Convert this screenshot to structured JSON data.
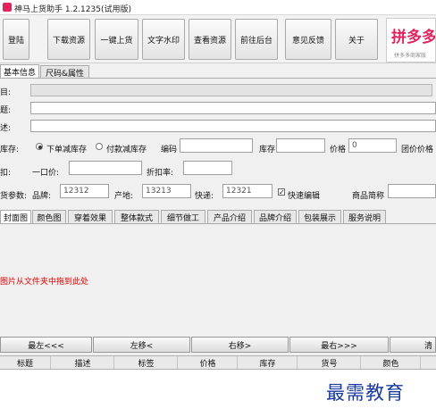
{
  "window": {
    "title": "神马上货助手 1.2.1235(试用版)"
  },
  "toolbar": {
    "buttons": [
      "登陆",
      "下载资源",
      "一键上货",
      "文字水印",
      "查看资源",
      "前往后台",
      "意见反馈",
      "关于"
    ]
  },
  "brand": {
    "logo_text": "拼多多",
    "sub_text": "拼多多商家版"
  },
  "main_tabs": [
    "基本信息",
    "尺码&属性"
  ],
  "form": {
    "category_label": "目:",
    "title_label": "题:",
    "desc_label": "述:",
    "stock_label": "库存:",
    "stock_options": [
      "下单减库存",
      "付款减库存"
    ],
    "code_label": "编码",
    "code_value": "",
    "stock_qty_label": "库存",
    "stock_qty_value": "",
    "price_label": "价格",
    "price_value": "0",
    "group_price_label": "团价价格",
    "discount_label": "扣:",
    "single_price_label": "一口价:",
    "single_price_value": "",
    "discount_rate_label": "折扣率:",
    "discount_rate_value": "",
    "goods_params_label": "货参数:",
    "brand_label": "品牌:",
    "brand_value": "12312",
    "origin_label": "产地:",
    "origin_value": "13213",
    "express_label": "快递:",
    "express_value": "12321",
    "quick_edit_label": "快速编辑",
    "quick_edit_checked": "✓",
    "short_name_label": "商品简称",
    "short_name_value": ""
  },
  "image_tabs": [
    "封面图",
    "颜色图",
    "穿着效果",
    "整体款式",
    "细节做工",
    "产品介绍",
    "品牌介绍",
    "包装展示",
    "服务说明"
  ],
  "image_area": {
    "hint": "图片从文件夹中拖到此处"
  },
  "move_buttons": [
    "最左<<<",
    "左移<",
    "右移>",
    "最右>>>",
    "清"
  ],
  "table": {
    "columns": [
      "标题",
      "描述",
      "标签",
      "价格",
      "库存",
      "货号",
      "颜色"
    ]
  },
  "watermark": "最需教育"
}
